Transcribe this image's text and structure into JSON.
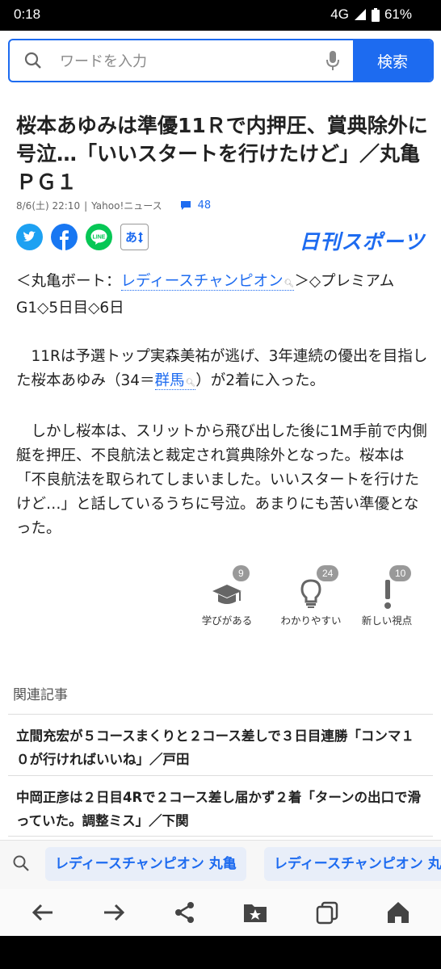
{
  "status": {
    "time": "0:18",
    "network": "4G",
    "battery": "61%"
  },
  "search": {
    "placeholder": "ワードを入力",
    "button": "検索"
  },
  "article": {
    "title": "桜本あゆみは準優11Ｒで内押圧、賞典除外に号泣…「いいスタートを行けたけど」／丸亀ＰＧ１",
    "date": "8/6(土) 22:10",
    "source": "Yahoo!ニュース",
    "comment_count": "48",
    "publisher": "日刊スポーツ",
    "font_button": "あ",
    "p1_pre": "＜丸亀ボート：",
    "p1_kw": "レディースチャンピオン",
    "p1_post": "＞◇プレミアムG1◇5日目◇6日",
    "p2_pre": "　11Rは予選トップ実森美祐が逃げ、3年連続の優出を目指した桜本あゆみ（34＝",
    "p2_kw": "群馬",
    "p2_post": "）が2着に入った。",
    "p3": "　しかし桜本は、スリットから飛び出した後に1M手前で内側艇を押圧、不良航法と裁定され賞典除外となった。桜本は「不良航法を取られてしまいました。いいスタートを行けたけど…」と話しているうちに号泣。あまりにも苦い準優となった。"
  },
  "reactions": [
    {
      "label": "学びがある",
      "count": "9",
      "icon": "graduation-cap-icon"
    },
    {
      "label": "わかりやすい",
      "count": "24",
      "icon": "lightbulb-icon"
    },
    {
      "label": "新しい視点",
      "count": "10",
      "icon": "exclamation-icon"
    }
  ],
  "related": {
    "title": "関連記事",
    "items": [
      "立間充宏が５コースまくりと２コース差しで３日目連勝「コンマ１０が行ければいいね」／戸田",
      "中岡正彦は２日目4Rで２コース差し届かず２着「ターンの出口で滑っていた。調整ミス」／下関"
    ]
  },
  "suggest_chips": [
    "レディースチャンピオン 丸亀",
    "レディースチャンピオン 丸"
  ],
  "nav": [
    "back-icon",
    "forward-icon",
    "share-icon",
    "bookmark-folder-icon",
    "tabs-icon",
    "home-icon"
  ],
  "colors": {
    "accent": "#1d6bf0",
    "twitter": "#1da1f2",
    "facebook": "#1877f2",
    "line": "#06c755"
  }
}
